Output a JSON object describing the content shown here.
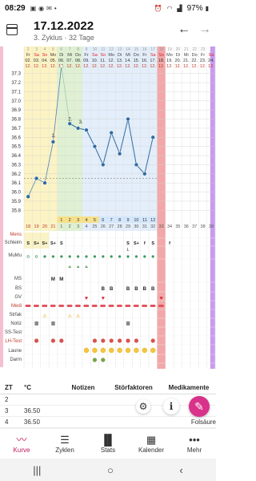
{
  "status": {
    "time": "08:29",
    "battery": "97%"
  },
  "header": {
    "date": "17.12.2022",
    "subtitle": "3. Zyklus · 32 Tage",
    "prev_icon": "arrow-left-icon",
    "next_icon": "arrow-right-icon"
  },
  "colors": {
    "accent": "#d9328a",
    "yellow_zone": "#fbf3c4",
    "green_zone": "#dff1d2",
    "blue_zone": "#e3eefa",
    "red_col": "#f2a8a8",
    "purple_col": "#c79cf0"
  },
  "chart": {
    "top_days": [
      "2",
      "3",
      "4",
      "5",
      "6",
      "7",
      "8",
      "9",
      "10",
      "11",
      "12",
      "13",
      "14",
      "15",
      "16",
      "17",
      "18",
      "19",
      "20",
      "21",
      "22",
      "23"
    ],
    "weekdays": [
      "Fr",
      "Sa",
      "So",
      "Mo",
      "Di",
      "Mi",
      "Do",
      "Fr",
      "Sa",
      "So",
      "Mo",
      "Di",
      "Mi",
      "Do",
      "Fr",
      "Sa",
      "So",
      "Mo",
      "Di",
      "Mi",
      "Do",
      "Fr",
      "Sa"
    ],
    "dates": [
      "02.",
      "03.",
      "04.",
      "05.",
      "06.",
      "07.",
      "08.",
      "09.",
      "10.",
      "11.",
      "12.",
      "13.",
      "14.",
      "15.",
      "16.",
      "17.",
      "18.",
      "19.",
      "20.",
      "21.",
      "22.",
      "23.",
      "24."
    ],
    "months": [
      "12.",
      "12.",
      "12.",
      "12.",
      "12.",
      "12.",
      "12.",
      "12.",
      "12.",
      "12.",
      "12.",
      "12.",
      "12.",
      "12.",
      "12.",
      "12.",
      "12.",
      "12.",
      "12.",
      "12.",
      "12.",
      "12.",
      "12."
    ],
    "temp_axis": [
      "37.3",
      "37.2",
      "37.1",
      "37.0",
      "36.9",
      "36.8",
      "36.7",
      "36.6",
      "36.5",
      "36.4",
      "36.3",
      "36.2",
      "36.1",
      "36.0",
      "35.9",
      "35.8"
    ],
    "cycle_days": [
      "18",
      "19",
      "20",
      "21",
      "1",
      "2",
      "3",
      "4",
      "25",
      "26",
      "27",
      "28",
      "29",
      "30",
      "31",
      "32",
      "33",
      "34",
      "35",
      "36",
      "37",
      "38",
      "39"
    ],
    "bottom_cycle_highlight": [
      "1",
      "2",
      "3",
      "4",
      "5",
      "6",
      "7",
      "8",
      "9",
      "10",
      "11",
      "12"
    ],
    "phase_labels": [
      "1.",
      "2.",
      "3."
    ],
    "row_labels": [
      "Mens",
      "Schleim",
      "MuMu",
      "MS",
      "BS",
      "GV",
      "Medi",
      "Strfak",
      "Notiz",
      "SS-Test",
      "LH-Test",
      "Laune",
      "Darm"
    ],
    "ms_marks": [
      "M",
      "M"
    ],
    "bs_marks": [
      "B",
      "B",
      "B",
      "B",
      "B",
      "B"
    ],
    "s_marks": [
      "S",
      "S+",
      "S+",
      "S+",
      "S",
      "S",
      "S+",
      "f",
      "S",
      "f"
    ],
    "l_mark": "L"
  },
  "chart_data": {
    "type": "line",
    "ylabel": "°C",
    "ylim": [
      35.8,
      37.3
    ],
    "x": [
      "02.12.",
      "03.12.",
      "04.12.",
      "05.12.",
      "06.12.",
      "07.12.",
      "08.12.",
      "09.12.",
      "10.12.",
      "11.12.",
      "12.12.",
      "13.12.",
      "14.12.",
      "15.12.",
      "16.12.",
      "17.12."
    ],
    "series": [
      {
        "values": [
          35.95,
          36.15,
          36.1,
          36.55,
          37.38,
          36.75,
          36.7,
          36.68,
          36.5,
          36.3,
          36.65,
          36.42,
          36.8,
          36.3,
          36.2,
          36.6
        ]
      }
    ],
    "coverline": 36.15
  },
  "table": {
    "headers": [
      "ZT",
      "°C",
      "Notizen",
      "Störfaktoren",
      "Medikamente"
    ],
    "rows": [
      {
        "zt": "2",
        "temp": "",
        "med": ""
      },
      {
        "zt": "3",
        "temp": "36.50",
        "med": "Fo"
      },
      {
        "zt": "4",
        "temp": "36.50",
        "med": "Folsäure"
      }
    ]
  },
  "fabs": {
    "info": "i",
    "edit_icon": "pencil-icon",
    "gear_icon": "gear-icon"
  },
  "nav": [
    {
      "label": "Kurve",
      "icon": "curve-icon"
    },
    {
      "label": "Zyklen",
      "icon": "list-icon"
    },
    {
      "label": "Stats",
      "icon": "bar-chart-icon"
    },
    {
      "label": "Kalender",
      "icon": "calendar-icon"
    },
    {
      "label": "Mehr",
      "icon": "more-icon"
    }
  ]
}
